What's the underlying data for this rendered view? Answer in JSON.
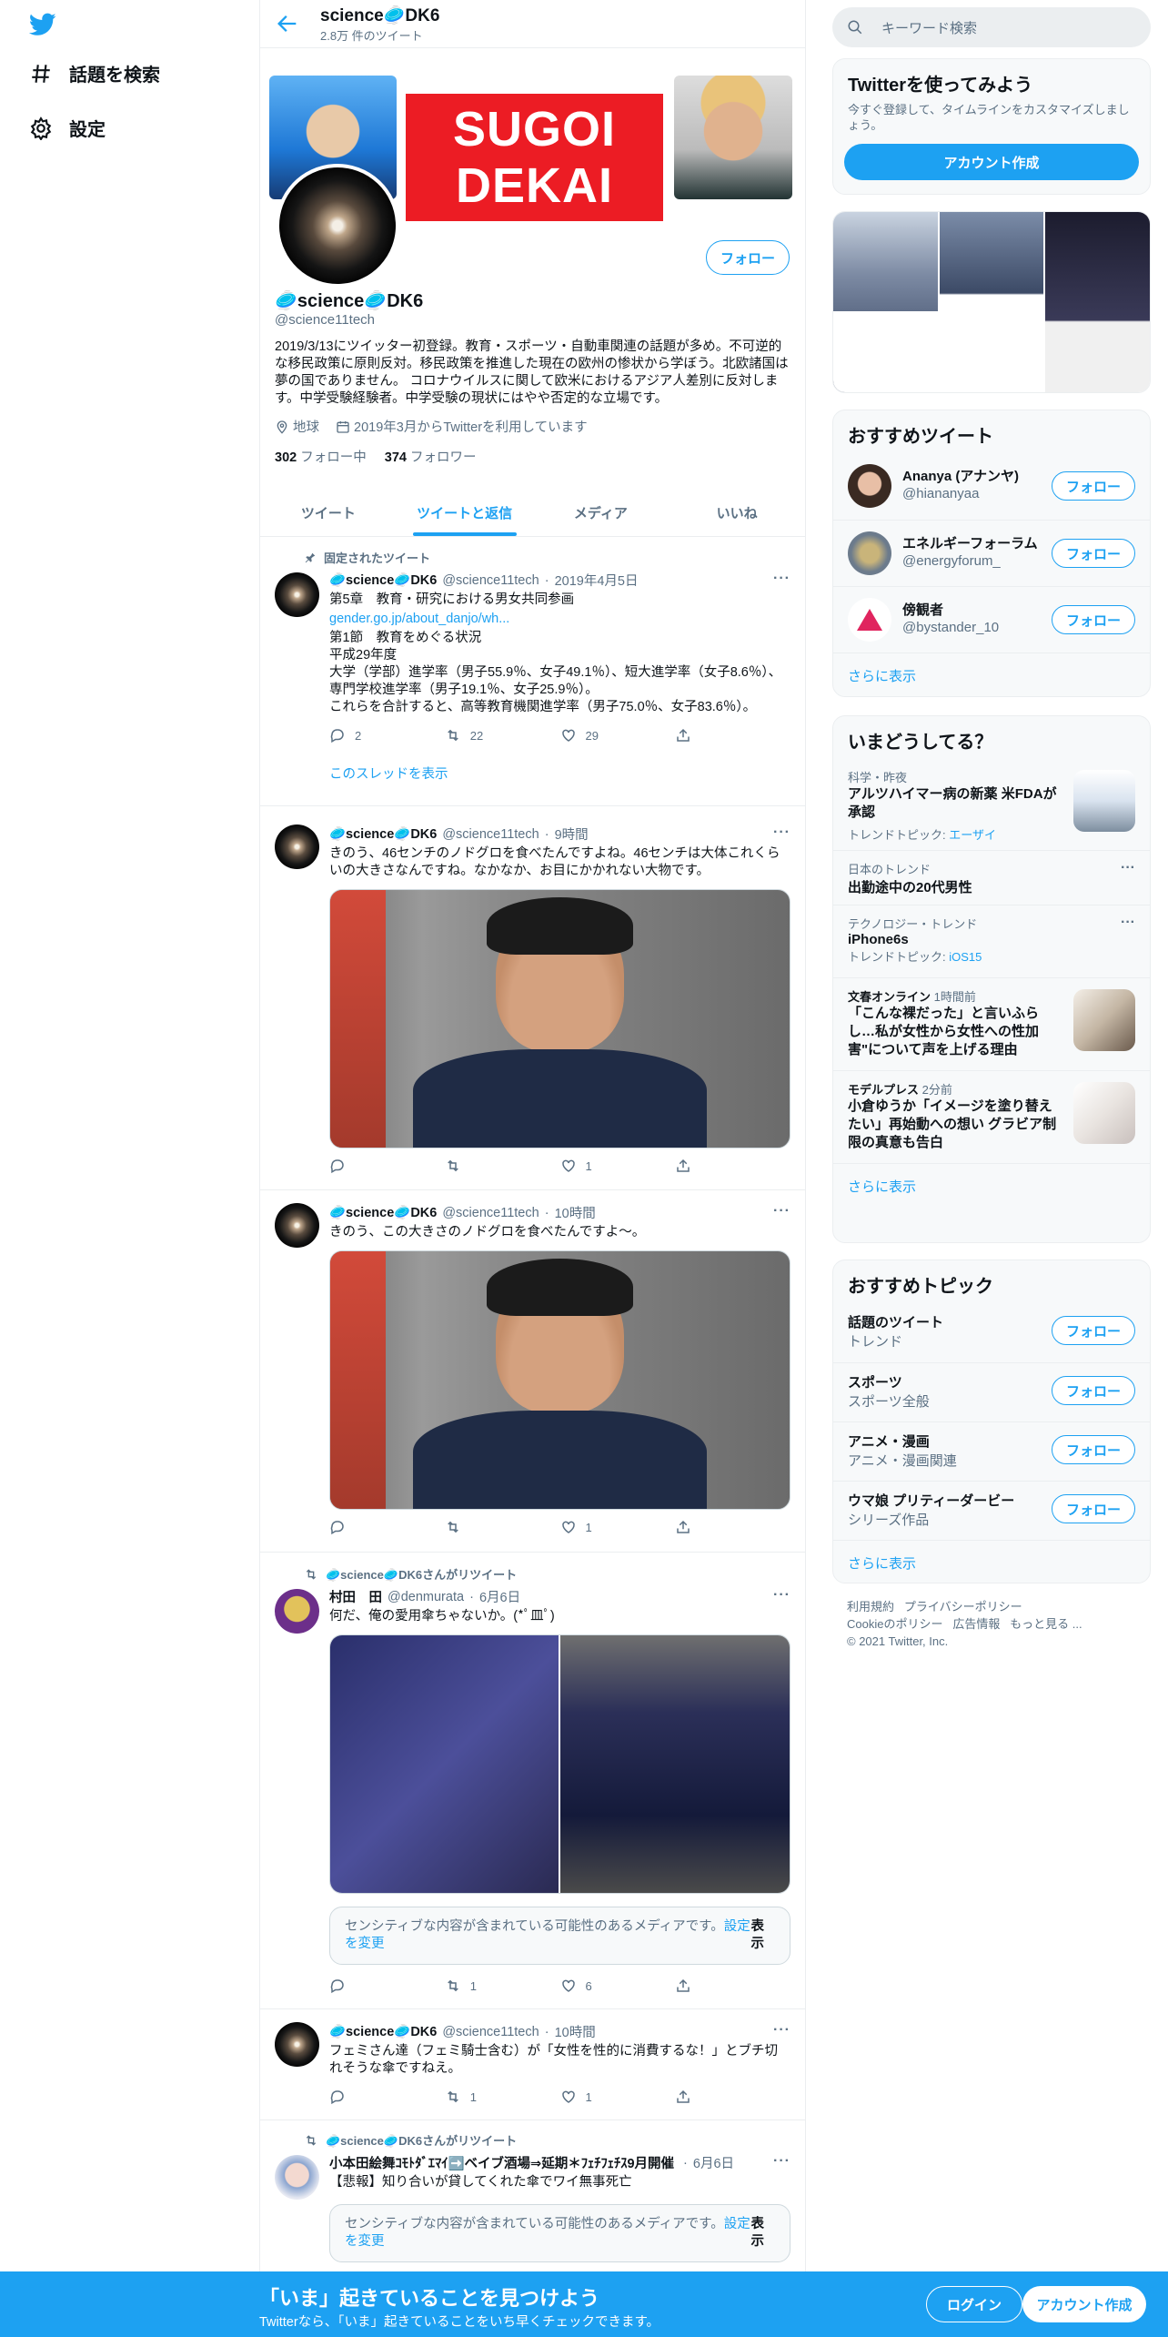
{
  "nav": {
    "explore": "話題を検索",
    "settings": "設定"
  },
  "header": {
    "name": "science🥏DK6",
    "tweet_count": "2.8万 件のツイート"
  },
  "banner": {
    "line1": "SUGOI",
    "line2": "DEKAI"
  },
  "profile": {
    "follow": "フォロー",
    "name": "🥏science🥏DK6",
    "handle": "@science11tech",
    "bio": "2019/3/13にツイッター初登録。教育・スポーツ・自動車関連の話題が多め。不可逆的な移民政策に原則反対。移民政策を推進した現在の欧州の惨状から学ぼう。北欧諸国は夢の国でありません。 コロナウイルスに関して欧米におけるアジア人差別に反対します。中学受験経験者。中学受験の現状にはやや否定的な立場です。",
    "location": "地球",
    "joined": "2019年3月からTwitterを利用しています",
    "following_count": "302",
    "following_label": "フォロー中",
    "followers_count": "374",
    "followers_label": "フォロワー"
  },
  "tabs": [
    "ツイート",
    "ツイートと返信",
    "メディア",
    "いいね"
  ],
  "tweets": [
    {
      "pinned_label": "固定されたツイート",
      "name": "🥏science🥏DK6",
      "handle": "@science11tech",
      "time": "2019年4月5日",
      "line1": "第5章　教育・研究における男女共同参画",
      "link": "gender.go.jp/about_danjo/wh...",
      "text": "第1節　教育をめぐる状況\n平成29年度\n大学（学部）進学率（男子55.9％、女子49.1％）、短大進学率（女子8.6％）、専門学校進学率（男子19.1％、女子25.9％）。\nこれらを合計すると、高等教育機関進学率（男子75.0％、女子83.6％）。",
      "replies": "2",
      "retweets": "22",
      "likes": "29",
      "thread": "このスレッドを表示"
    },
    {
      "name": "🥏science🥏DK6",
      "handle": "@science11tech",
      "time": "9時間",
      "text": "きのう、46センチのノドグロを食べたんですよね。46センチは大体これくらいの大きさなんですね。なかなか、お目にかかれない大物です。",
      "replies": "",
      "retweets": "",
      "likes": "1"
    },
    {
      "name": "🥏science🥏DK6",
      "handle": "@science11tech",
      "time": "10時間",
      "text": "きのう、この大きさのノドグロを食べたんですよ～。",
      "replies": "",
      "retweets": "",
      "likes": "1"
    },
    {
      "rt_label": "🥏science🥏DK6さんがリツイート",
      "name": "村田　田",
      "handle": "@denmurata",
      "time": "6月6日",
      "text": "何だ、俺の愛用傘ちゃないか。(*ﾟ皿ﾟ)",
      "sensitive": "センシティブな内容が含まれている可能性のあるメディアです。",
      "sensitive_link": "設定を変更",
      "show": "表示",
      "replies": "",
      "retweets": "1",
      "likes": "6"
    },
    {
      "name": "🥏science🥏DK6",
      "handle": "@science11tech",
      "time": "10時間",
      "text": "フェミさん達（フェミ騎士含む）が「女性を性的に消費するな！」とブチ切れそうな傘ですねえ。",
      "replies": "",
      "retweets": "1",
      "likes": "1"
    },
    {
      "rt_label": "🥏science🥏DK6さんがリツイート",
      "name": "小本田絵舞ｺﾓﾄﾀﾞｴﾏｲ➡️ベイブ酒場⇒延期＊ﾌｪﾁﾌｪﾁｽ9月開催",
      "time": "6月6日",
      "text": "【悲報】知り合いが貸してくれた傘でワイ無事死亡",
      "sensitive": "センシティブな内容が含まれている可能性のあるメディアです。",
      "sensitive_link": "設定を変更",
      "show": "表示"
    }
  ],
  "right": {
    "search_placeholder": "キーワード検索",
    "signup_card": {
      "title": "Twitterを使ってみよう",
      "text": "今すぐ登録して、タイムラインをカスタマイズしましょう。",
      "button": "アカウント作成"
    },
    "recommended": {
      "title": "おすすめツイート",
      "items": [
        {
          "name": "Ananya (アナンヤ)",
          "handle": "@hiananyaa",
          "button": "フォロー"
        },
        {
          "name": "エネルギーフォーラム",
          "handle": "@energyforum_",
          "button": "フォロー"
        },
        {
          "name": "傍観者",
          "handle": "@bystander_10",
          "button": "フォロー"
        }
      ],
      "more": "さらに表示"
    },
    "trends": {
      "title": "いまどうしてる？",
      "items": [
        {
          "meta": "科学・昨夜",
          "title": "アルツハイマー病の新薬 米FDAが承認",
          "sub_label": "トレンドトピック:",
          "sub_link": "エーザイ"
        },
        {
          "meta": "日本のトレンド",
          "title": "出勤途中の20代男性"
        },
        {
          "meta": "テクノロジー・トレンド",
          "title": "iPhone6s",
          "sub_label": "トレンドトピック:",
          "sub_link": "iOS15"
        },
        {
          "source": "文春オンライン",
          "time": "1時間前",
          "title": "「こんな裸だった」と言いふらし…私が女性から女性への性加害\"について声を上げる理由"
        },
        {
          "source": "モデルプレス",
          "time": "2分前",
          "title": "小倉ゆうか「イメージを塗り替えたい」再始動への想い グラビア制限の真意も告白"
        }
      ],
      "more": "さらに表示"
    },
    "topics": {
      "title": "おすすめトピック",
      "items": [
        {
          "name": "話題のツイート",
          "sub": "トレンド",
          "button": "フォロー"
        },
        {
          "name": "スポーツ",
          "sub": "スポーツ全般",
          "button": "フォロー"
        },
        {
          "name": "アニメ・漫画",
          "sub": "アニメ・漫画関連",
          "button": "フォロー"
        },
        {
          "name": "ウマ娘 プリティーダービー",
          "sub": "シリーズ作品",
          "button": "フォロー"
        }
      ],
      "more": "さらに表示"
    },
    "footer": {
      "l1": "利用規約",
      "l2": "プライバシーポリシー",
      "l3": "Cookieのポリシー",
      "l4": "広告情報",
      "l5": "もっと見る ...",
      "copyright": "© 2021 Twitter, Inc."
    }
  },
  "bottom": {
    "title": "「いま」起きていることを見つけよう",
    "sub": "Twitterなら、「いま」起きていることをいち早くチェックできます。",
    "login": "ログイン",
    "signup": "アカウント作成"
  },
  "colors": {
    "accent": "#1da1f2",
    "text": "#0f1419",
    "muted": "#5b7083"
  }
}
